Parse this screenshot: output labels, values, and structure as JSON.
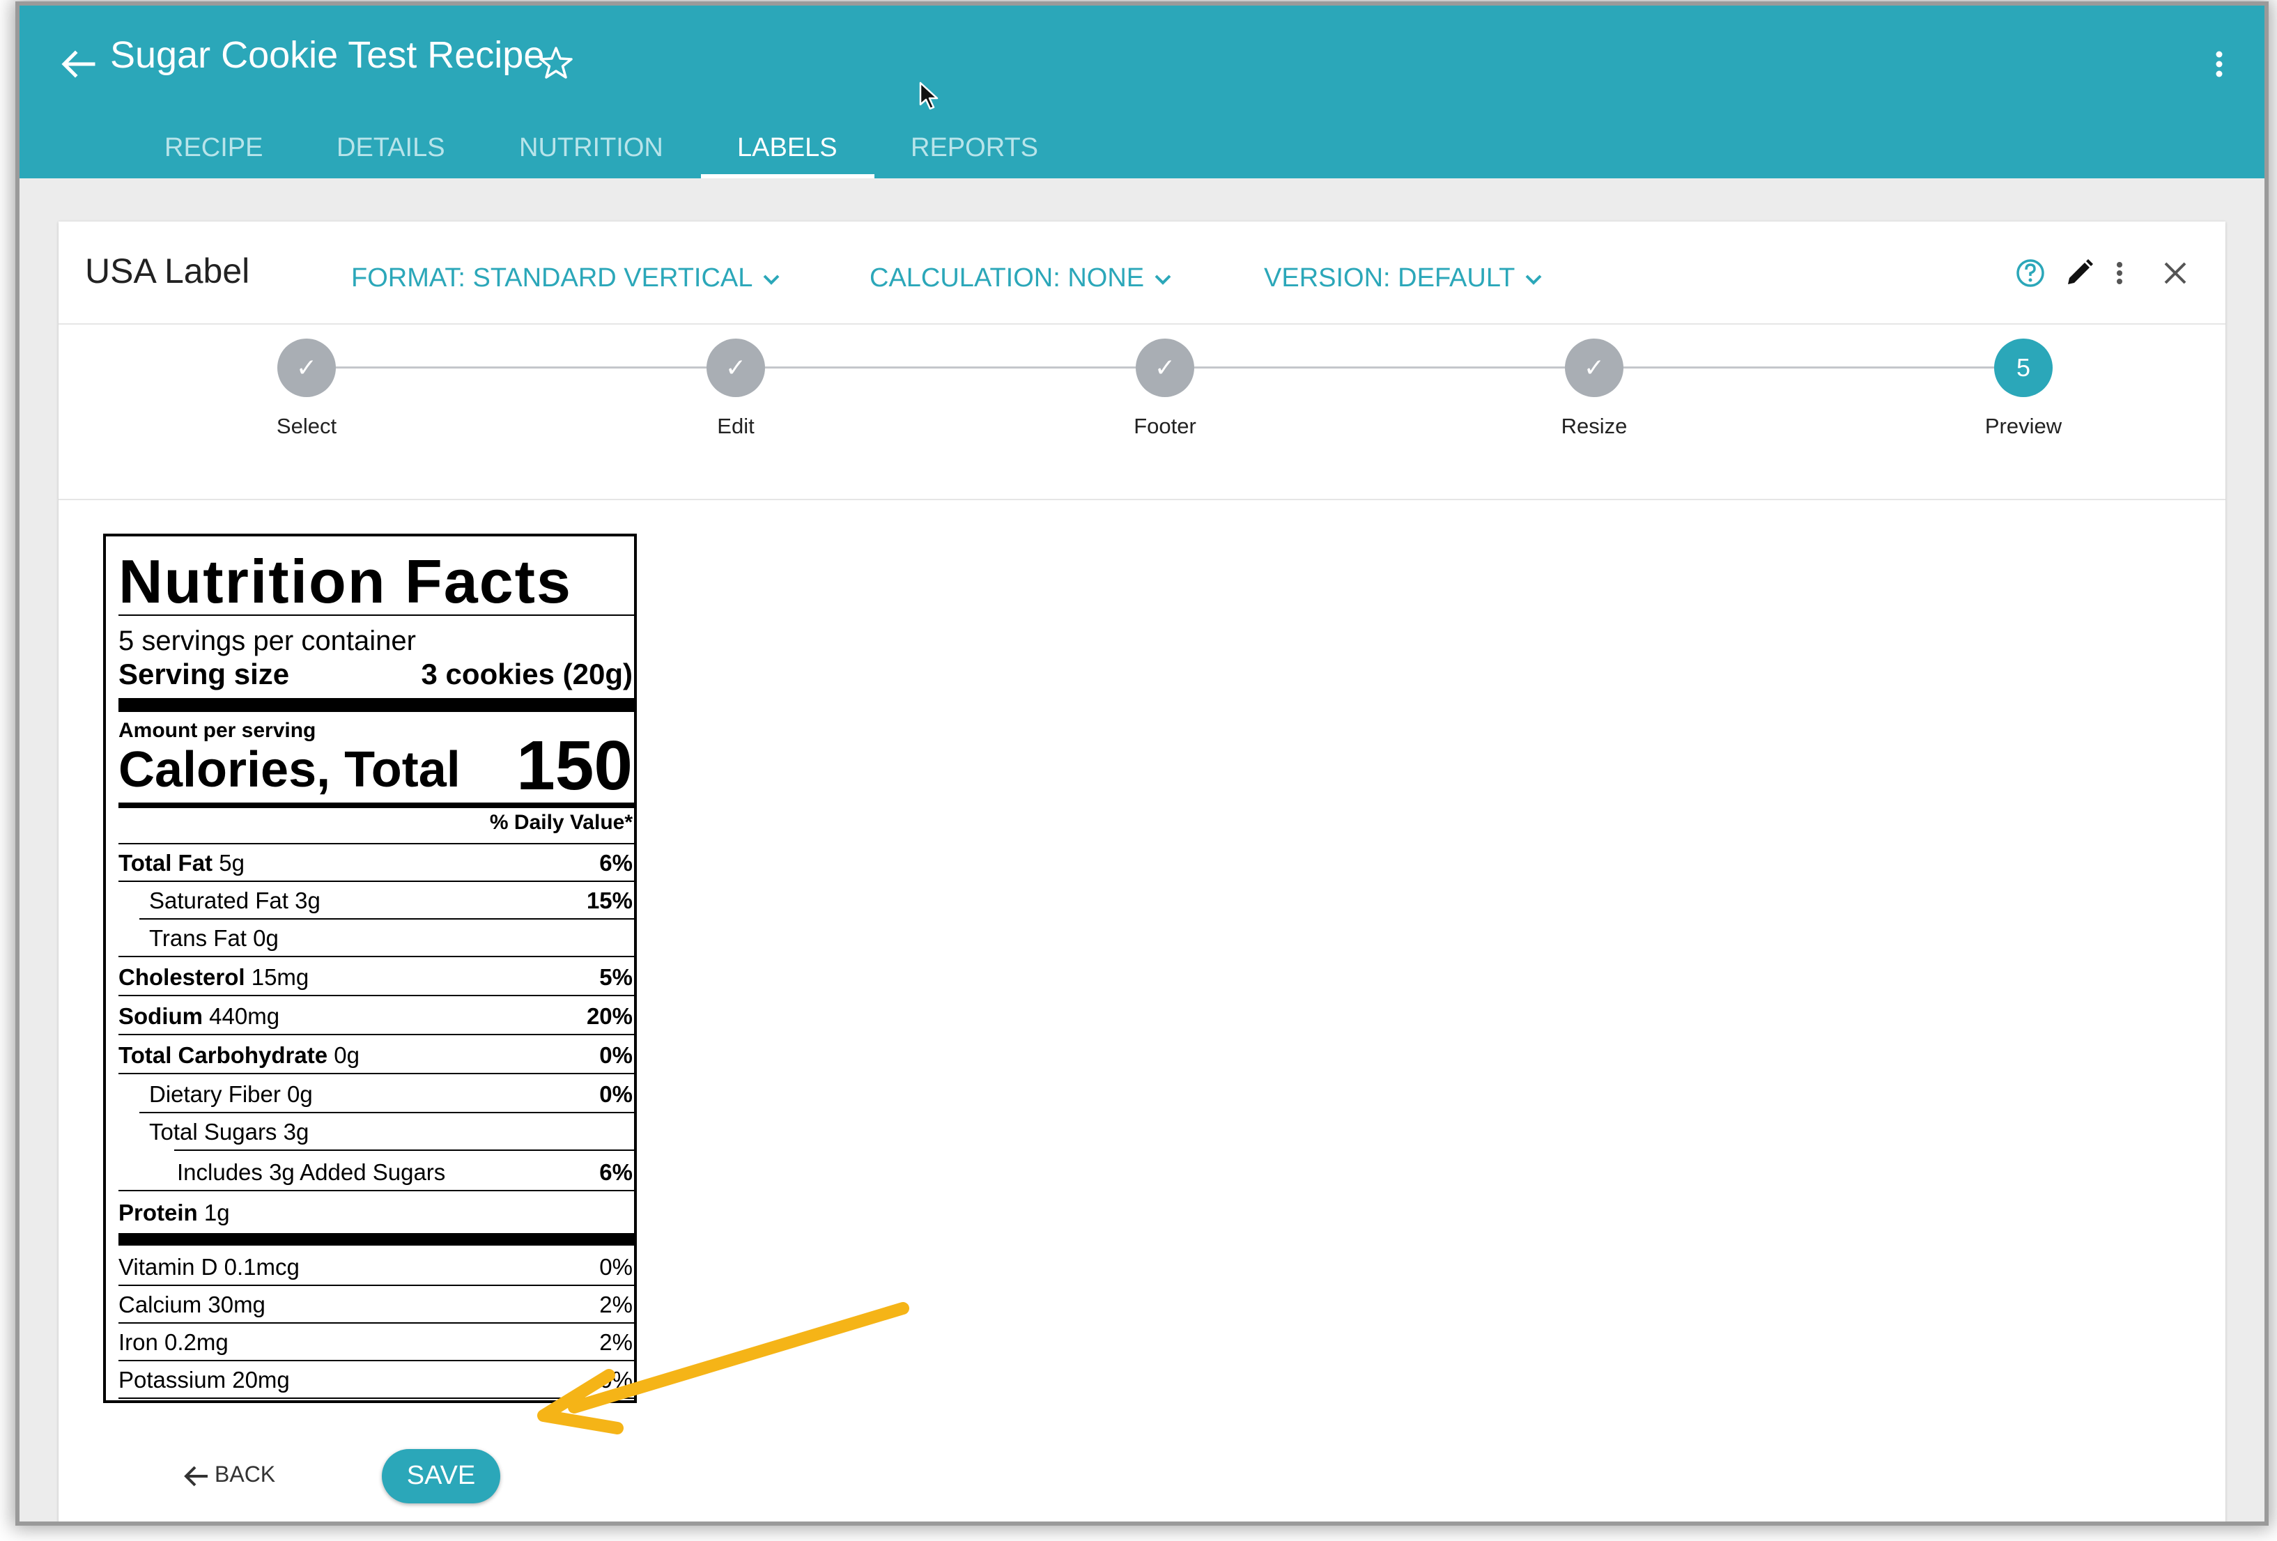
{
  "header": {
    "title": "Sugar Cookie Test Recipe",
    "tabs": [
      {
        "label": "RECIPE"
      },
      {
        "label": "DETAILS"
      },
      {
        "label": "NUTRITION"
      },
      {
        "label": "LABELS"
      },
      {
        "label": "REPORTS"
      }
    ],
    "active_tab": "LABELS"
  },
  "card": {
    "title": "USA Label",
    "format": "FORMAT: STANDARD VERTICAL",
    "calculation": "CALCULATION: NONE",
    "version": "VERSION: DEFAULT"
  },
  "stepper": {
    "steps": [
      {
        "label": "Select",
        "mark": "✓"
      },
      {
        "label": "Edit",
        "mark": "✓"
      },
      {
        "label": "Footer",
        "mark": "✓"
      },
      {
        "label": "Resize",
        "mark": "✓"
      },
      {
        "label": "Preview",
        "mark": "5"
      }
    ],
    "current_step": 5
  },
  "nutrition": {
    "title": "Nutrition Facts",
    "servings": "5 servings per container",
    "serving_size_label": "Serving size",
    "serving_size_value": "3 cookies (20g)",
    "amount_per_serving": "Amount per serving",
    "calories_label": "Calories, Total",
    "calories_value": "150",
    "dv_header": "% Daily Value*",
    "rows": [
      {
        "name": "Total Fat",
        "amount": " 5g",
        "dv": "6%"
      },
      {
        "name": "Saturated Fat 3g",
        "amount": "",
        "dv": "15%"
      },
      {
        "name": "Trans Fat 0g",
        "amount": "",
        "dv": ""
      },
      {
        "name": "Cholesterol",
        "amount": " 15mg",
        "dv": "5%"
      },
      {
        "name": "Sodium",
        "amount": " 440mg",
        "dv": "20%"
      },
      {
        "name": "Total Carbohydrate",
        "amount": " 0g",
        "dv": "0%"
      },
      {
        "name": "Dietary Fiber 0g",
        "amount": "",
        "dv": "0%"
      },
      {
        "name": "Total Sugars 3g",
        "amount": "",
        "dv": ""
      },
      {
        "name": "Includes 3g Added Sugars",
        "amount": "",
        "dv": "6%"
      },
      {
        "name": "Protein",
        "amount": " 1g",
        "dv": ""
      }
    ],
    "vitamins": [
      {
        "name": "Vitamin D 0.1mcg",
        "dv": "0%"
      },
      {
        "name": "Calcium 30mg",
        "dv": "2%"
      },
      {
        "name": "Iron 0.2mg",
        "dv": "2%"
      },
      {
        "name": "Potassium 20mg",
        "dv": "0%"
      }
    ]
  },
  "actions": {
    "back_label": "BACK",
    "save_label": "SAVE"
  },
  "colors": {
    "primary": "#2ba7b9",
    "step_done": "#a9aeb4",
    "annotation_arrow": "#f5b417"
  }
}
